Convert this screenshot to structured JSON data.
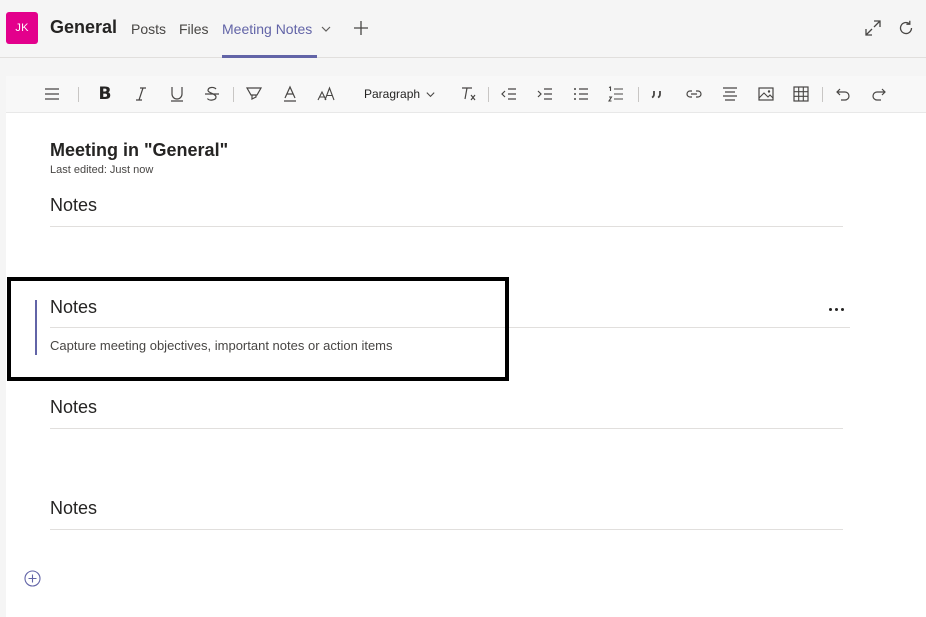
{
  "header": {
    "avatar_initials": "JK",
    "team_name": "General",
    "tabs": [
      {
        "label": "Posts"
      },
      {
        "label": "Files"
      },
      {
        "label": "Meeting Notes",
        "active": true
      }
    ],
    "icons": [
      "chevron-down-icon",
      "add-icon",
      "expand-icon",
      "refresh-icon"
    ]
  },
  "toolbar": {
    "bold": "B",
    "paragraph_label": "Paragraph",
    "icons": [
      "hamburger-icon",
      "bold-icon",
      "italic-icon",
      "underline-icon",
      "strikethrough-icon",
      "highlight-icon",
      "font-color-icon",
      "font-size-icon",
      "clear-format-icon",
      "outdent-icon",
      "indent-icon",
      "bullet-list-icon",
      "numbered-list-icon",
      "quote-icon",
      "link-icon",
      "align-icon",
      "image-icon",
      "table-icon",
      "undo-icon",
      "redo-icon"
    ]
  },
  "page": {
    "title": "Meeting in \"General\"",
    "last_edited": "Last edited: Just now"
  },
  "sections": [
    {
      "heading": "Notes"
    },
    {
      "heading": "Notes",
      "description": "Capture meeting objectives, important notes or action items"
    },
    {
      "heading": "Notes"
    },
    {
      "heading": "Notes"
    }
  ],
  "colors": {
    "accent": "#6264a7",
    "avatar": "#e3008c"
  }
}
